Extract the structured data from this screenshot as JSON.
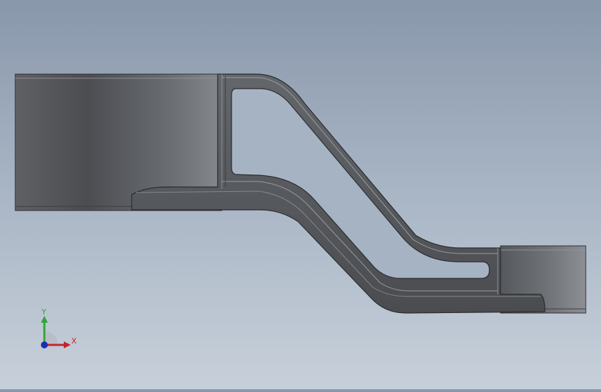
{
  "viewport": {
    "background_top": "#8997ab",
    "background_bottom": "#c7d0da",
    "model_color": "#5a5c5f"
  },
  "triad": {
    "x_label": "X",
    "y_label": "Y",
    "x_color": "#c0262b",
    "y_color": "#2fa63a",
    "z_color": "#1c2fb0"
  }
}
